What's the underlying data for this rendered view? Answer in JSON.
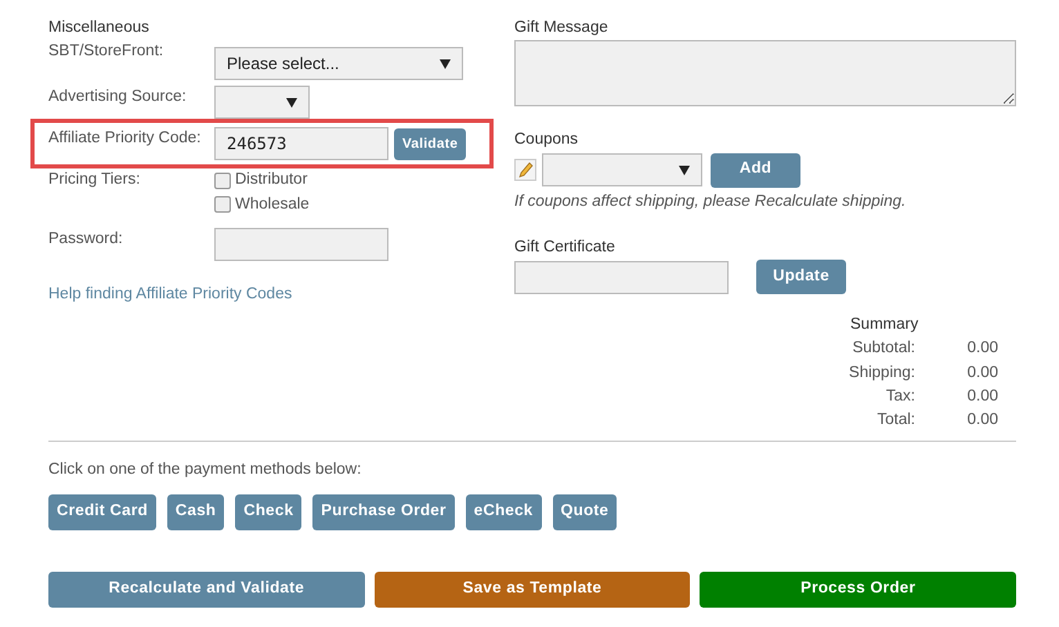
{
  "miscellaneous": {
    "heading": "Miscellaneous",
    "storefront": {
      "label": "SBT/StoreFront:",
      "value": "Please select..."
    },
    "advertising_source": {
      "label": "Advertising Source:"
    },
    "affiliate": {
      "label": "Affiliate Priority Code:",
      "value": "246573",
      "button": "Validate",
      "highlighted": true
    },
    "pricing_tiers": {
      "label": "Pricing Tiers:",
      "options": [
        {
          "label": "Distributor",
          "checked": false
        },
        {
          "label": "Wholesale",
          "checked": false
        }
      ]
    },
    "password": {
      "label": "Password:"
    },
    "help_link": "Help finding Affiliate Priority Codes"
  },
  "gift_message": {
    "label": "Gift Message"
  },
  "coupons": {
    "label": "Coupons",
    "button": "Add",
    "note": "If coupons affect shipping, please Recalculate shipping."
  },
  "gift_certificate": {
    "label": "Gift Certificate",
    "button": "Update"
  },
  "summary": {
    "heading": "Summary",
    "rows": [
      {
        "label": "Subtotal:",
        "value": "0.00"
      },
      {
        "label": "Shipping:",
        "value": "0.00"
      },
      {
        "label": "Tax:",
        "value": "0.00"
      },
      {
        "label": "Total:",
        "value": "0.00"
      }
    ]
  },
  "payment": {
    "prompt": "Click on one of the payment methods below:",
    "methods": [
      "Credit Card",
      "Cash",
      "Check",
      "Purchase Order",
      "eCheck",
      "Quote"
    ]
  },
  "actions": [
    {
      "label": "Recalculate and Validate",
      "kind": "secondary"
    },
    {
      "label": "Save as Template",
      "kind": "warning"
    },
    {
      "label": "Process Order",
      "kind": "success"
    }
  ]
}
